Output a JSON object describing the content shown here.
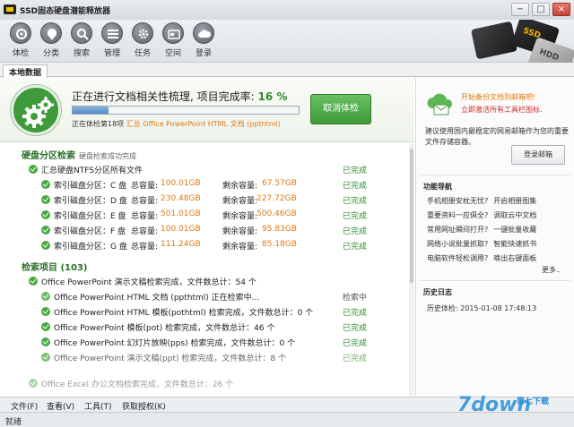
{
  "window": {
    "title": "SSD固态硬盘潜能释放器",
    "buttons": [
      "−",
      "□",
      "×"
    ]
  },
  "toolbar": {
    "items": [
      {
        "label": "体检",
        "icon": "checkup-icon"
      },
      {
        "label": "分类",
        "icon": "classify-icon"
      },
      {
        "label": "搜索",
        "icon": "search-icon"
      },
      {
        "label": "管理",
        "icon": "manage-icon"
      },
      {
        "label": "任务",
        "icon": "task-icon"
      },
      {
        "label": "空间",
        "icon": "space-icon"
      },
      {
        "label": "登录",
        "icon": "cloud-icon"
      }
    ],
    "art_labels": [
      "SSD",
      "HDD"
    ]
  },
  "tabs": {
    "local": "本地数据"
  },
  "progress": {
    "title_prefix": "正在进行文档相关性梳理, 项目完成率:",
    "percent_text": "16 %",
    "percent": 16,
    "sub_prefix": "正在体检第18项",
    "sub_file": "汇总 Office PowerPoint HTML 文档 (ppthtml)",
    "cancel_label": "取消体检"
  },
  "partition_section": {
    "title": "硬盘分区检索",
    "subtitle": "硬盘检索成功完成",
    "summary": {
      "label": "汇总硬盘NTFS分区所有文件",
      "status": "已完成"
    },
    "drives": [
      {
        "label": "索引磁盘分区：C 盘",
        "total_label": "总容量:",
        "total": "100.01GB",
        "free_label": "剩余容量:",
        "free": "67.57GB",
        "status": "已完成"
      },
      {
        "label": "索引磁盘分区：D 盘",
        "total_label": "总容量:",
        "total": "230.48GB",
        "free_label": "剩余容量:",
        "free": "227.72GB",
        "status": "已完成"
      },
      {
        "label": "索引磁盘分区：E 盘",
        "total_label": "总容量:",
        "total": "501.01GB",
        "free_label": "剩余容量:",
        "free": "500.46GB",
        "status": "已完成"
      },
      {
        "label": "索引磁盘分区：F 盘",
        "total_label": "总容量:",
        "total": "100.01GB",
        "free_label": "剩余容量:",
        "free": "95.83GB",
        "status": "已完成"
      },
      {
        "label": "索引磁盘分区：G 盘",
        "total_label": "总容量:",
        "total": "111.24GB",
        "free_label": "剩余容量:",
        "free": "85.18GB",
        "status": "已完成"
      }
    ]
  },
  "search_section": {
    "title": "检索项目",
    "count": "(103)",
    "group": "Office PowerPoint 演示文稿检索完成，文件数总计：54 个",
    "items": [
      {
        "label": "Office PowerPoint HTML 文档 (ppthtml) 正在检索中...",
        "status": "检索中"
      },
      {
        "label": "Office PowerPoint HTML 模板(pothtml) 检索完成，文件数总计：0 个",
        "status": "已完成"
      },
      {
        "label": "Office PowerPoint 模板(pot) 检索完成，文件数总计：46 个",
        "status": "已完成"
      },
      {
        "label": "Office PowerPoint 幻灯片放映(pps) 检索完成，文件数总计：0 个",
        "status": "已完成"
      },
      {
        "label": "Office PowerPoint 演示文稿(ppt) 检索完成，文件数总计：8 个",
        "status": "已完成"
      }
    ],
    "next_group": "Office Excel 办公文档检索完成，文件数总计：26 个"
  },
  "sidebar": {
    "promo_line1": "开始备份文档到邮箱吧!",
    "promo_line2": "立即激活所有工具栏图标.",
    "desc": "建议使用国内最稳定的网易邮箱作为您的重要文件存储容器。",
    "login_label": "登录邮箱",
    "nav_title": "功能导航",
    "nav_rows": [
      [
        "手机相册安枕无忧?",
        "开启相册图集"
      ],
      [
        "重要资料一应俱全?",
        "调取云中文档"
      ],
      [
        "常用网址瞬间打开?",
        "一键批量收藏"
      ],
      [
        "网络小说批量抓取?",
        "智能快速抓书"
      ],
      [
        "电脑软件轻松调用?",
        "唤出右键面板"
      ]
    ],
    "more": "更多..",
    "history_title": "历史日志",
    "history_label": "历史体检:",
    "history_time": "2015-01-08 17:48:13"
  },
  "menu": {
    "items": [
      "文件(F)",
      "查看(V)",
      "工具(T)",
      "获取授权(K)"
    ]
  },
  "status": {
    "text": "就绪"
  },
  "watermark": {
    "big": "7down",
    "small": "第七下载"
  },
  "colors": {
    "accent_green": "#3d9a38",
    "orange": "#e07a13",
    "red": "#d42626"
  }
}
